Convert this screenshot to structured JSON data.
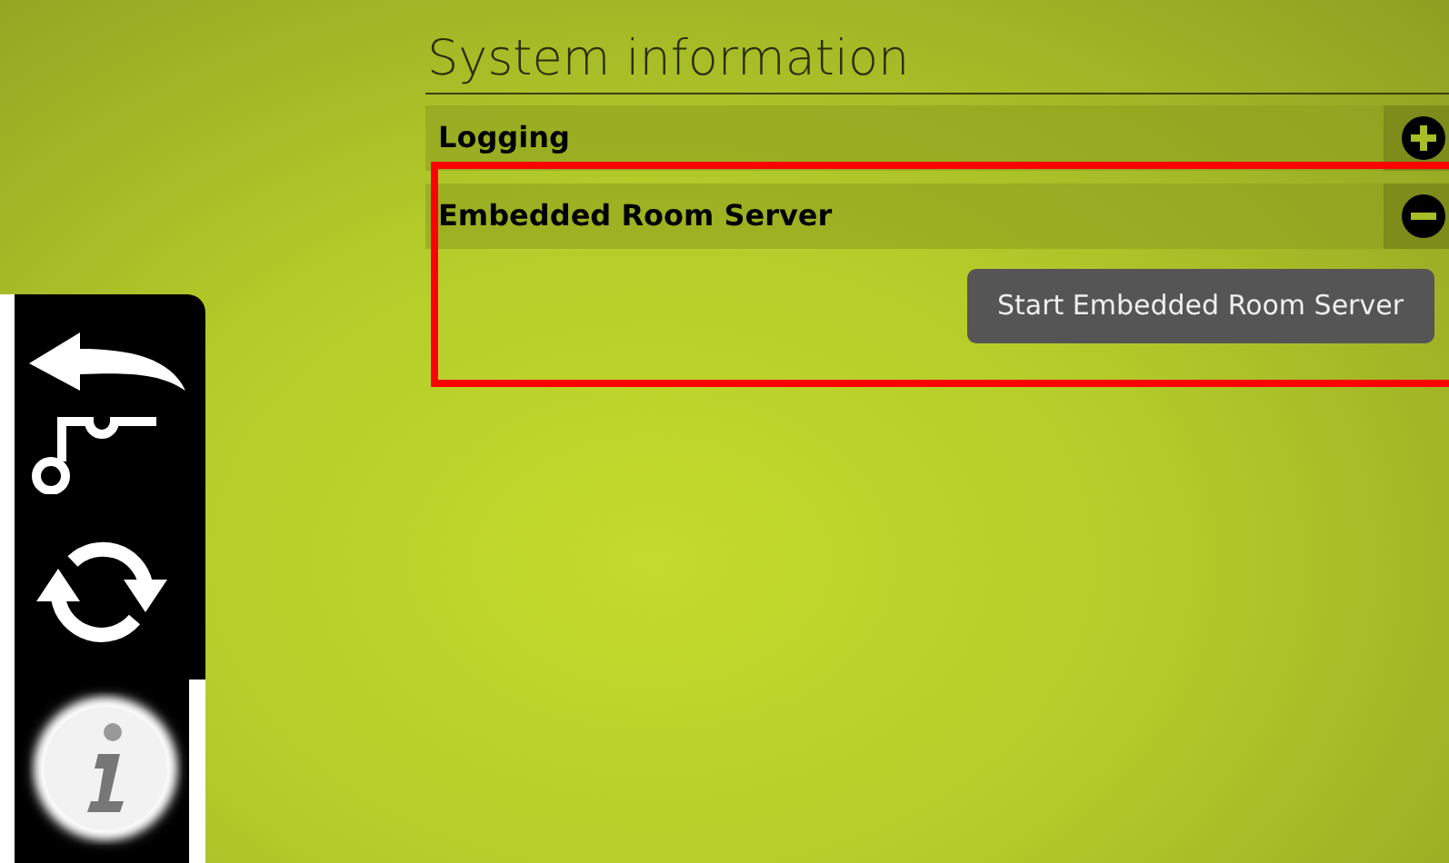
{
  "nav": [
    {
      "kind": "back",
      "selected": false
    },
    {
      "kind": "hook",
      "selected": false
    },
    {
      "kind": "refresh",
      "selected": false
    },
    {
      "kind": "info",
      "selected": true
    }
  ],
  "title": "System information",
  "sections": [
    {
      "label": "Logging",
      "expanded": false,
      "highlighted": false
    },
    {
      "label": "Embedded Room Server",
      "expanded": true,
      "highlighted": true,
      "button": "Start Embedded Room Server"
    }
  ]
}
